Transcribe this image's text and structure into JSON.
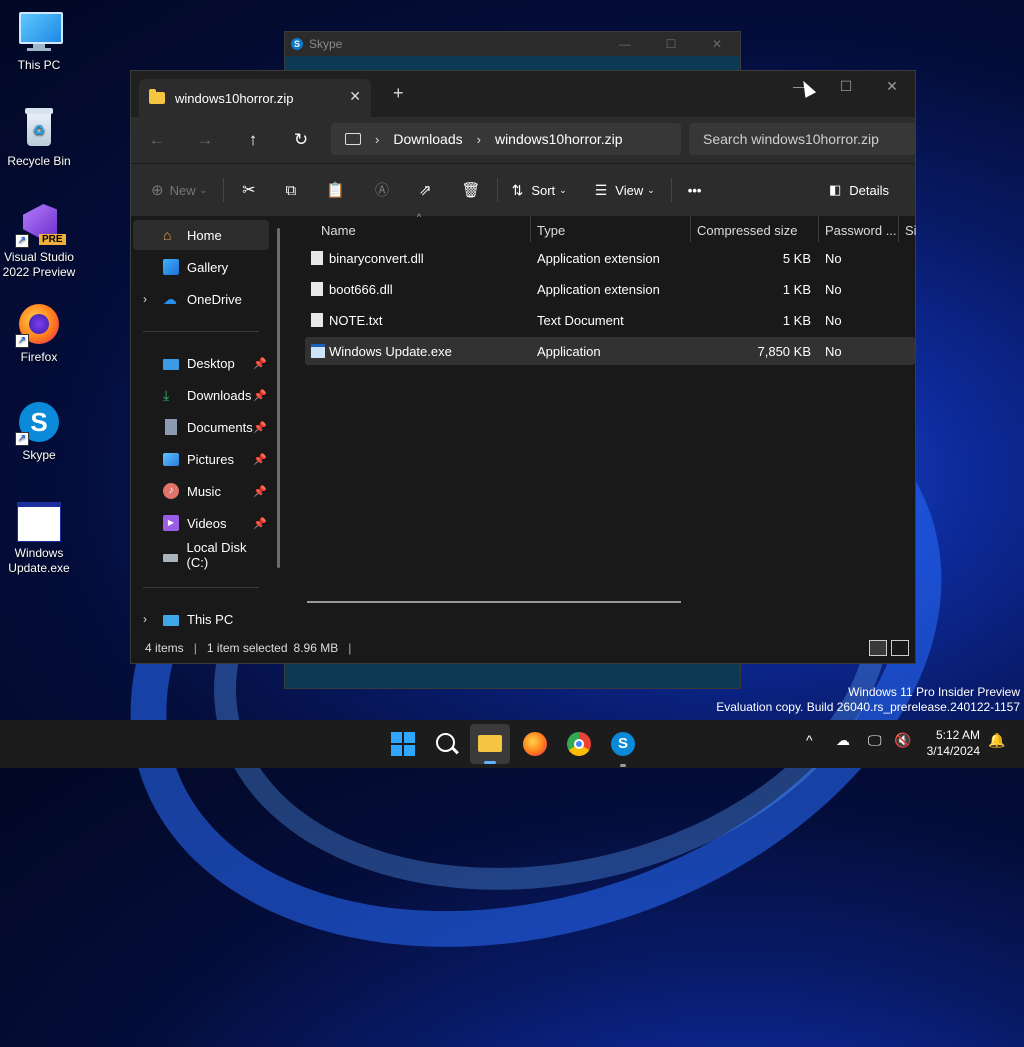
{
  "desktop": {
    "icons": [
      {
        "label": "This PC"
      },
      {
        "label": "Recycle Bin"
      },
      {
        "label": "Visual Studio 2022 Preview",
        "badge": "PRE"
      },
      {
        "label": "Firefox"
      },
      {
        "label": "Skype"
      },
      {
        "label": "Windows Update.exe"
      }
    ]
  },
  "skype_window": {
    "title": "Skype"
  },
  "explorer": {
    "tab_title": "windows10horror.zip",
    "address": {
      "segments": [
        "Downloads",
        "windows10horror.zip"
      ]
    },
    "search": {
      "placeholder": "Search windows10horror.zip"
    },
    "toolbar": {
      "new_label": "New",
      "sort_label": "Sort",
      "view_label": "View",
      "more_label": "•••",
      "details_label": "Details"
    },
    "nav": {
      "items": [
        {
          "label": "Home"
        },
        {
          "label": "Gallery"
        },
        {
          "label": "OneDrive"
        },
        {
          "label": "Desktop"
        },
        {
          "label": "Downloads"
        },
        {
          "label": "Documents"
        },
        {
          "label": "Pictures"
        },
        {
          "label": "Music"
        },
        {
          "label": "Videos"
        },
        {
          "label": "Local Disk (C:)"
        },
        {
          "label": "This PC"
        }
      ]
    },
    "columns": [
      "Name",
      "Type",
      "Compressed size",
      "Password ...",
      "Si"
    ],
    "files": [
      {
        "name": "binaryconvert.dll",
        "type": "Application extension",
        "size": "5 KB",
        "password": "No"
      },
      {
        "name": "boot666.dll",
        "type": "Application extension",
        "size": "1 KB",
        "password": "No"
      },
      {
        "name": "NOTE.txt",
        "type": "Text Document",
        "size": "1 KB",
        "password": "No"
      },
      {
        "name": "Windows Update.exe",
        "type": "Application",
        "size": "7,850 KB",
        "password": "No"
      }
    ],
    "status": {
      "count": "4 items",
      "selection": "1 item selected",
      "size": "8.96 MB"
    }
  },
  "watermark": {
    "line1": "Windows 11 Pro Insider Preview",
    "line2": "Evaluation copy. Build 26040.rs_prerelease.240122-1157"
  },
  "clock": {
    "time": "5:12 AM",
    "date": "3/14/2024"
  },
  "colors": {
    "accent": "#0a79c8",
    "folder": "#f5c542",
    "window_bg": "#191919",
    "toolbar_bg": "#2c2c2c"
  }
}
